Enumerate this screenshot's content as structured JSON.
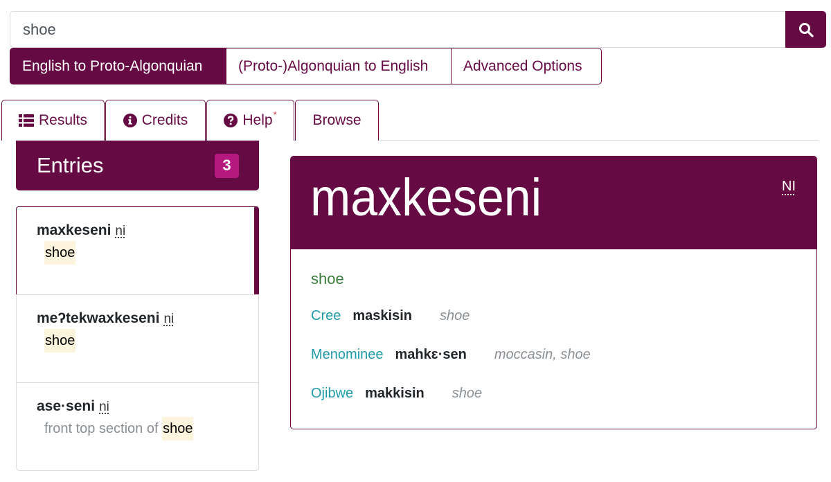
{
  "search": {
    "value": "shoe",
    "button_icon": "search-icon"
  },
  "modes": [
    {
      "label": "English to Proto-Algonquian",
      "active": true
    },
    {
      "label": "(Proto-)Algonquian to English",
      "active": false
    },
    {
      "label": "Advanced Options",
      "active": false
    }
  ],
  "tabs": [
    {
      "label": "Results",
      "icon": "list-icon"
    },
    {
      "label": "Credits",
      "icon": "info-circle-icon"
    },
    {
      "label": "Help",
      "icon": "question-circle-icon",
      "marker": "*"
    },
    {
      "label": "Browse"
    }
  ],
  "entries": {
    "title": "Entries",
    "count": "3",
    "items": [
      {
        "headword": "maxkeseni",
        "pos": "ni",
        "gloss_prefix": "",
        "gloss_match": "shoe",
        "active": true
      },
      {
        "headword": "meʔtekwaxkeseni",
        "pos": "ni",
        "gloss_prefix": "",
        "gloss_match": "shoe",
        "active": false
      },
      {
        "headword": "ase·seni",
        "pos": "ni",
        "gloss_prefix": "front top section of ",
        "gloss_match": "shoe",
        "active": false
      }
    ]
  },
  "detail": {
    "headword": "maxkeseni",
    "pos": "NI",
    "gloss": "shoe",
    "reflexes": [
      {
        "language": "Cree",
        "form": "maskisin",
        "gloss": "shoe"
      },
      {
        "language": "Menominee",
        "form": "mahkɛ·sen",
        "gloss": "moccasin, shoe"
      },
      {
        "language": "Ojibwe",
        "form": "makkisin",
        "gloss": "shoe"
      }
    ]
  },
  "colors": {
    "brand": "#660a44",
    "badge": "#b5197f",
    "highlight": "#fdf4de",
    "language_link": "#1e9aa8",
    "gloss_green": "#3a7d3a"
  }
}
